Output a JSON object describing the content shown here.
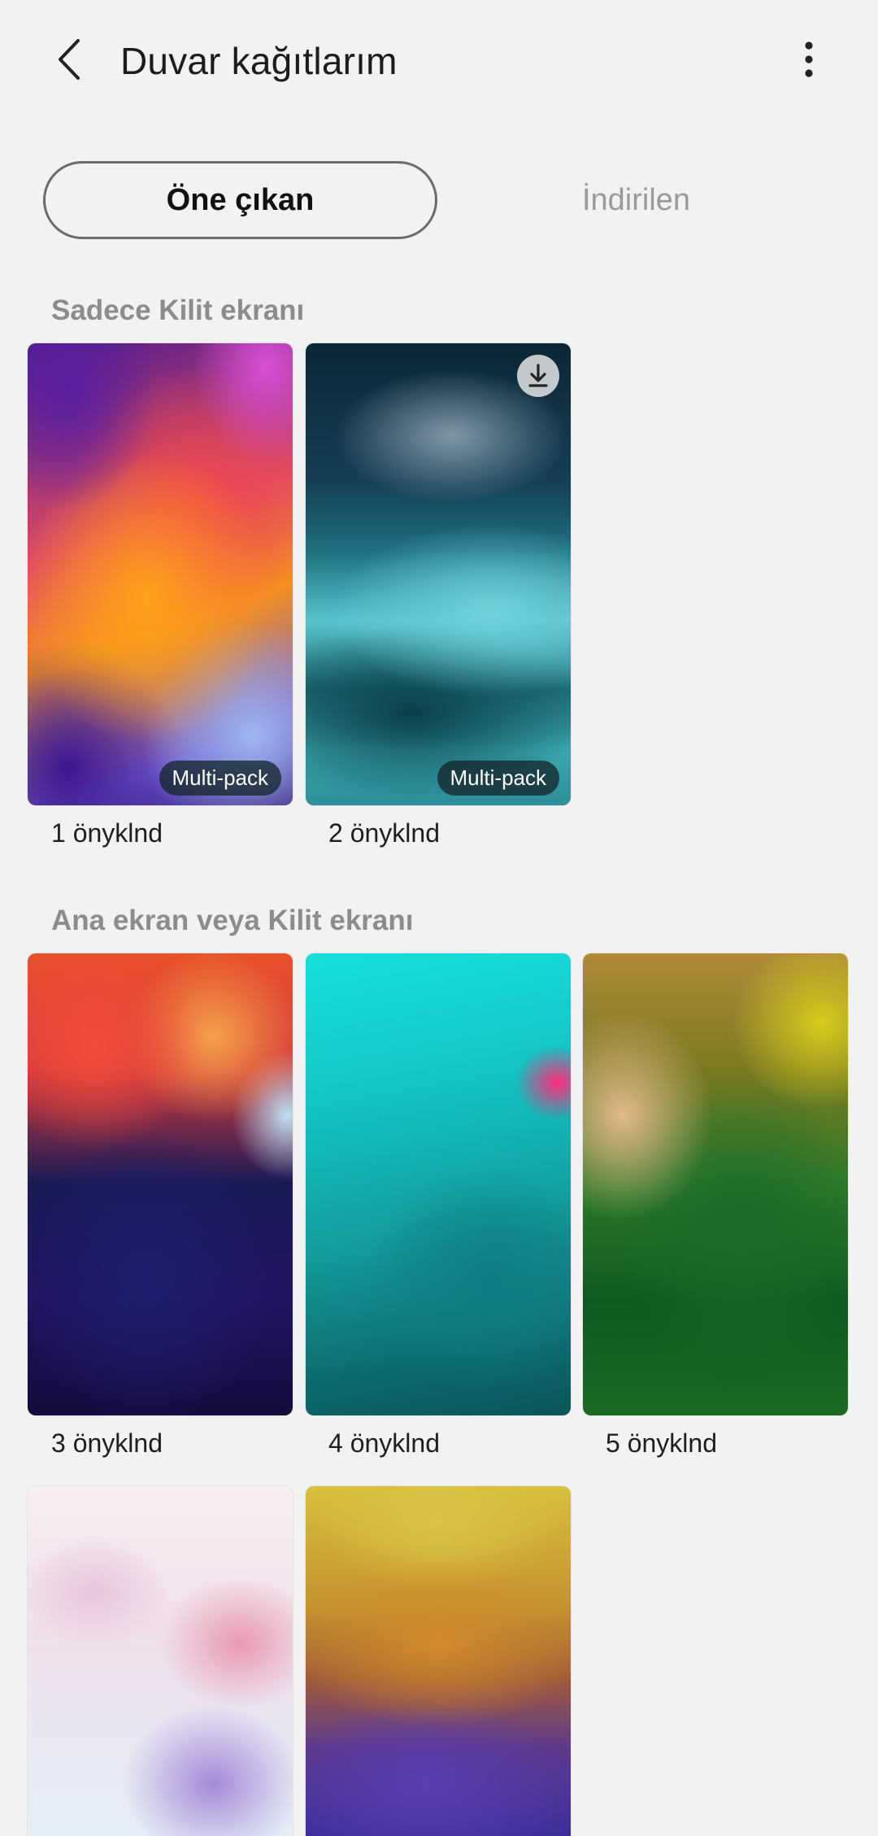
{
  "header": {
    "title": "Duvar kağıtlarım",
    "back_icon": "chevron-left-icon",
    "more_icon": "more-vert-icon"
  },
  "tabs": [
    {
      "label": "Öne çıkan",
      "selected": true
    },
    {
      "label": "İndirilen",
      "selected": false
    }
  ],
  "sections": [
    {
      "title": "Sadece Kilit ekranı",
      "items": [
        {
          "caption": "1 önyklnd",
          "badge": "Multi-pack",
          "download_icon": false
        },
        {
          "caption": "2 önyklnd",
          "badge": "Multi-pack",
          "download_icon": true
        }
      ]
    },
    {
      "title": "Ana ekran veya Kilit ekranı",
      "items": [
        {
          "caption": "3 önyklnd"
        },
        {
          "caption": "4 önyklnd"
        },
        {
          "caption": "5 önyklnd"
        },
        {
          "caption": ""
        },
        {
          "caption": ""
        }
      ]
    }
  ],
  "colors": {
    "background": "#f2f2f2",
    "section_title": "#8c8c8c",
    "inactive_tab": "#9a9a9a"
  }
}
